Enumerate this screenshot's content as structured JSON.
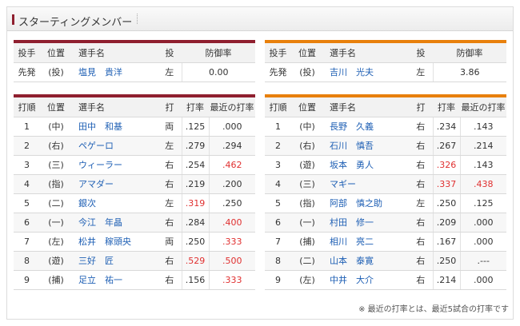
{
  "header": {
    "title": "スターティングメンバー"
  },
  "pitcher_headers": [
    "投手",
    "位置",
    "選手名",
    "投",
    "防御率"
  ],
  "batter_headers": [
    "打順",
    "位置",
    "選手名",
    "打",
    "打率",
    "最近の打率"
  ],
  "teams": {
    "home": {
      "color": "#8f1f2f",
      "pitcher": {
        "role": "先発",
        "pos": "(投)",
        "name": "塩見　貴洋",
        "hand": "左",
        "era": "0.00"
      },
      "batters": [
        {
          "order": "1",
          "pos": "(中)",
          "name": "田中　和基",
          "hand": "両",
          "avg": ".125",
          "recent": ".000",
          "avg_red": false,
          "recent_red": false
        },
        {
          "order": "2",
          "pos": "(右)",
          "name": "ペゲーロ",
          "hand": "左",
          "avg": ".279",
          "recent": ".294",
          "avg_red": false,
          "recent_red": false
        },
        {
          "order": "3",
          "pos": "(三)",
          "name": "ウィーラー",
          "hand": "右",
          "avg": ".254",
          "recent": ".462",
          "avg_red": false,
          "recent_red": true
        },
        {
          "order": "4",
          "pos": "(指)",
          "name": "アマダー",
          "hand": "右",
          "avg": ".219",
          "recent": ".200",
          "avg_red": false,
          "recent_red": false
        },
        {
          "order": "5",
          "pos": "(二)",
          "name": "銀次",
          "hand": "左",
          "avg": ".319",
          "recent": ".250",
          "avg_red": true,
          "recent_red": false
        },
        {
          "order": "6",
          "pos": "(一)",
          "name": "今江　年晶",
          "hand": "右",
          "avg": ".284",
          "recent": ".400",
          "avg_red": false,
          "recent_red": true
        },
        {
          "order": "7",
          "pos": "(左)",
          "name": "松井　稼頭央",
          "hand": "両",
          "avg": ".250",
          "recent": ".333",
          "avg_red": false,
          "recent_red": true
        },
        {
          "order": "8",
          "pos": "(遊)",
          "name": "三好　匠",
          "hand": "右",
          "avg": ".529",
          "recent": ".500",
          "avg_red": true,
          "recent_red": true
        },
        {
          "order": "9",
          "pos": "(捕)",
          "name": "足立　祐一",
          "hand": "右",
          "avg": ".156",
          "recent": ".333",
          "avg_red": false,
          "recent_red": true
        }
      ]
    },
    "away": {
      "color": "#e8800c",
      "pitcher": {
        "role": "先発",
        "pos": "(投)",
        "name": "吉川　光夫",
        "hand": "左",
        "era": "3.86"
      },
      "batters": [
        {
          "order": "1",
          "pos": "(中)",
          "name": "長野　久義",
          "hand": "右",
          "avg": ".234",
          "recent": ".143",
          "avg_red": false,
          "recent_red": false
        },
        {
          "order": "2",
          "pos": "(右)",
          "name": "石川　慎吾",
          "hand": "右",
          "avg": ".267",
          "recent": ".214",
          "avg_red": false,
          "recent_red": false
        },
        {
          "order": "3",
          "pos": "(遊)",
          "name": "坂本　勇人",
          "hand": "右",
          "avg": ".326",
          "recent": ".143",
          "avg_red": true,
          "recent_red": false
        },
        {
          "order": "4",
          "pos": "(三)",
          "name": "マギー",
          "hand": "右",
          "avg": ".337",
          "recent": ".438",
          "avg_red": true,
          "recent_red": true
        },
        {
          "order": "5",
          "pos": "(指)",
          "name": "阿部　慎之助",
          "hand": "左",
          "avg": ".250",
          "recent": ".125",
          "avg_red": false,
          "recent_red": false
        },
        {
          "order": "6",
          "pos": "(一)",
          "name": "村田　修一",
          "hand": "右",
          "avg": ".209",
          "recent": ".000",
          "avg_red": false,
          "recent_red": false
        },
        {
          "order": "7",
          "pos": "(捕)",
          "name": "相川　亮二",
          "hand": "右",
          "avg": ".167",
          "recent": ".000",
          "avg_red": false,
          "recent_red": false
        },
        {
          "order": "8",
          "pos": "(二)",
          "name": "山本　泰寛",
          "hand": "右",
          "avg": ".250",
          "recent": ".---",
          "avg_red": false,
          "recent_red": false
        },
        {
          "order": "9",
          "pos": "(左)",
          "name": "中井　大介",
          "hand": "右",
          "avg": ".214",
          "recent": ".000",
          "avg_red": false,
          "recent_red": false
        }
      ]
    }
  },
  "footnote": "※ 最近の打率とは、最近5試合の打率です"
}
